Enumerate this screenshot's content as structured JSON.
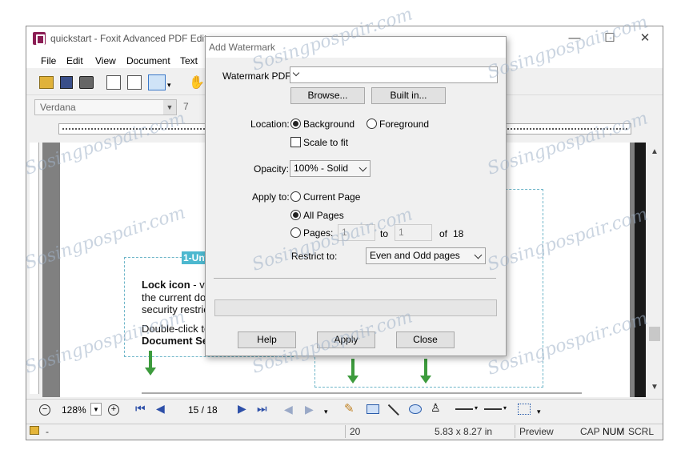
{
  "window": {
    "title": "quickstart - Foxit Advanced PDF Editor",
    "minimize": "—",
    "maximize": "☐",
    "close": "✕"
  },
  "menu": [
    "File",
    "Edit",
    "View",
    "Document",
    "Text"
  ],
  "toolbar": {
    "font": "Verdana",
    "font_size": "7"
  },
  "document": {
    "annotation_title": "1-Untitled",
    "lines": [
      {
        "bold": "Lock icon",
        "rest": " - visib"
      },
      {
        "bold": "",
        "rest": "the current docu"
      },
      {
        "bold": "",
        "rest": "security restricti"
      },
      {
        "bold": "",
        "rest": "Double-click to d"
      },
      {
        "bold": "Document Secu",
        "rest": ""
      }
    ]
  },
  "navigation": {
    "zoom": "128%",
    "page_indicator": "15 / 18"
  },
  "status": {
    "lock": "-",
    "page_number": "20",
    "page_size": "5.83 x 8.27 in",
    "mode": "Preview",
    "caps": "CAP",
    "num": "NUM",
    "scroll": "SCRL"
  },
  "dialog": {
    "title": "Add Watermark",
    "watermark_pdf_label": "Watermark PDF:",
    "watermark_pdf_value": "",
    "browse_button": "Browse...",
    "builtin_button": "Built in...",
    "location_label": "Location:",
    "background_label": "Background",
    "foreground_label": "Foreground",
    "location_selected": "Background",
    "scale_to_fit_label": "Scale to fit",
    "scale_to_fit_checked": false,
    "opacity_label": "Opacity:",
    "opacity_value": "100% - Solid",
    "apply_to_label": "Apply to:",
    "current_page_label": "Current Page",
    "all_pages_label": "All Pages",
    "pages_label": "Pages:",
    "apply_selected": "All Pages",
    "pages_from": "1",
    "to_label": "to",
    "pages_to": "1",
    "of_label": "of",
    "total_pages": "18",
    "restrict_label": "Restrict to:",
    "restrict_value": "Even and Odd pages",
    "help_button": "Help",
    "apply_button": "Apply",
    "close_button": "Close"
  },
  "watermark_text": "Sosingpospair.com"
}
